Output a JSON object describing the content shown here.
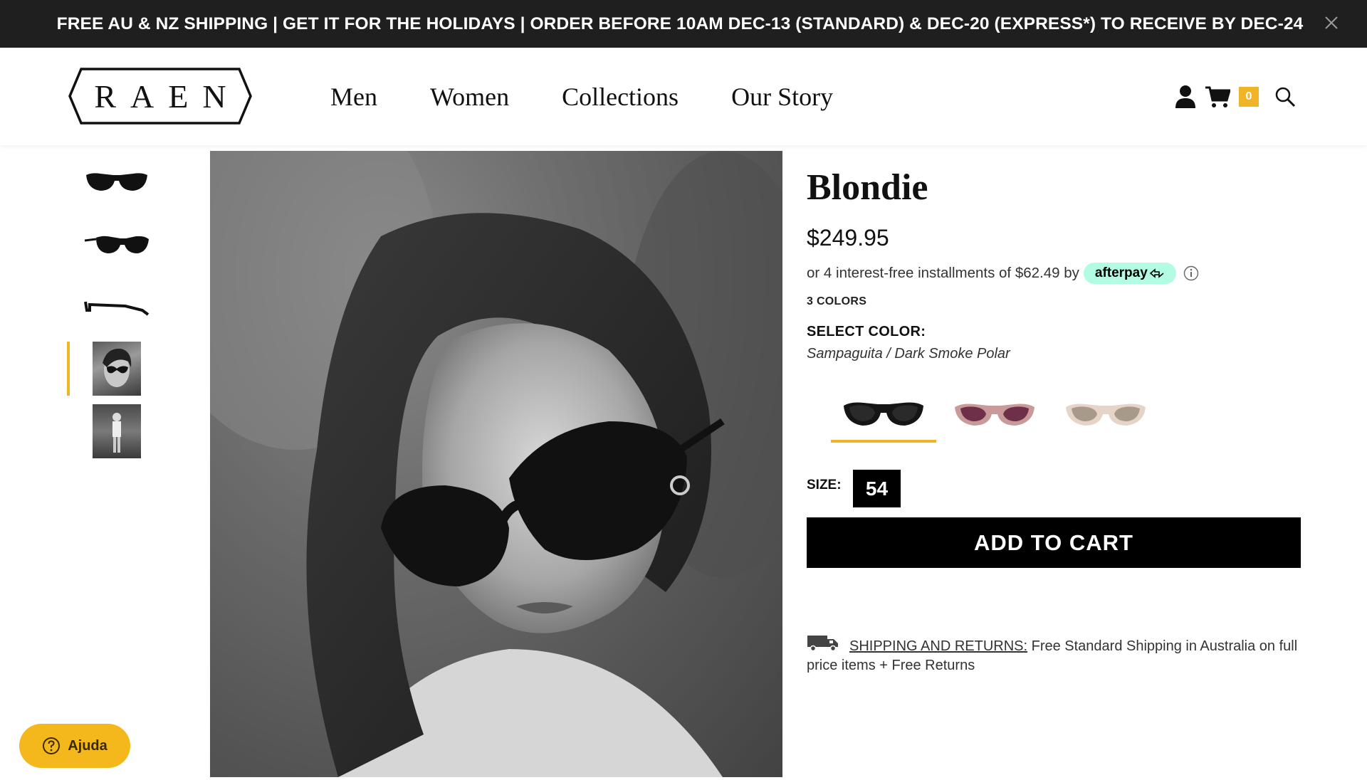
{
  "announcement": {
    "text": "FREE AU & NZ SHIPPING | GET IT FOR THE HOLIDAYS | ORDER BEFORE 10AM DEC-13 (STANDARD) & DEC-20 (EXPRESS*) TO RECEIVE BY DEC-24",
    "close_icon": "close-icon"
  },
  "header": {
    "logo_text": "RAEN",
    "nav": [
      "Men",
      "Women",
      "Collections",
      "Our Story"
    ],
    "icons": [
      "user-icon",
      "cart-icon",
      "search-icon"
    ],
    "cart_count": "0"
  },
  "gallery": {
    "thumbnails": [
      {
        "kind": "sunglasses-front-black"
      },
      {
        "kind": "sunglasses-angle-black"
      },
      {
        "kind": "sunglasses-side-black"
      },
      {
        "kind": "lifestyle-portrait",
        "active": true
      },
      {
        "kind": "lifestyle-full-body"
      }
    ],
    "main_image": "black-and-white portrait of woman wearing black cat-eye sunglasses"
  },
  "product": {
    "title": "Blondie",
    "price": "$249.95",
    "installments_text": "or 4 interest-free installments of $62.49 by",
    "afterpay_label": "afterpay",
    "colors_count": "3 COLORS",
    "select_color_label": "SELECT COLOR:",
    "selected_color": "Sampaguita / Dark Smoke Polar",
    "swatches": [
      {
        "name": "black",
        "frame": "#151515",
        "lens": "#2a2a2a",
        "selected": true
      },
      {
        "name": "rose",
        "frame": "#c89a9a",
        "lens": "#6e2f48",
        "selected": false
      },
      {
        "name": "champagne",
        "frame": "#e6d4c8",
        "lens": "#a89a8a",
        "selected": false
      }
    ],
    "size_label": "SIZE:",
    "size_value": "54",
    "add_to_cart": "ADD TO CART",
    "shipping_link": "SHIPPING AND RETURNS:",
    "shipping_text": "Free Standard Shipping in Australia on full price items + Free Returns"
  },
  "help": {
    "label": "Ajuda"
  },
  "colors": {
    "accent": "#f0b429",
    "afterpay": "#b2fce4",
    "announcement_bg": "#1f1f1f"
  }
}
